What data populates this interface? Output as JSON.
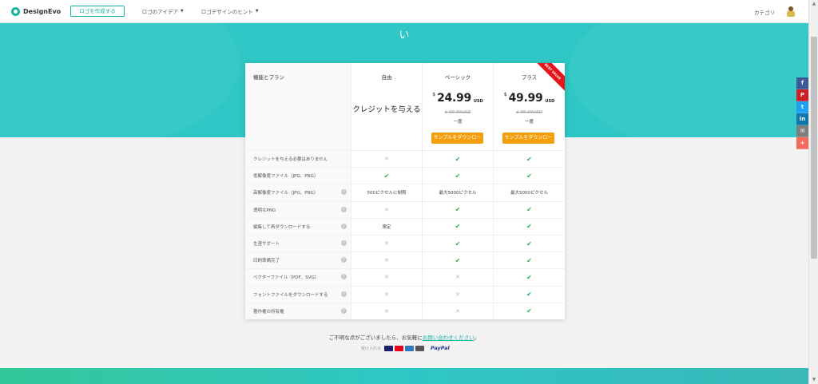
{
  "header": {
    "logo_text": "DesignEvo",
    "create_button": "ロゴを作成する",
    "nav": [
      {
        "label": "ロゴのアイデア"
      },
      {
        "label": "ロゴデザインのヒント"
      }
    ],
    "categories": "カテゴリ"
  },
  "hero": {
    "text": "い"
  },
  "share": [
    {
      "icon": "facebook-icon",
      "glyph": "f",
      "color": "#3b5998"
    },
    {
      "icon": "pinterest-icon",
      "glyph": "P",
      "color": "#cb2027"
    },
    {
      "icon": "twitter-icon",
      "glyph": "t",
      "color": "#1da1f2"
    },
    {
      "icon": "linkedin-icon",
      "glyph": "in",
      "color": "#0e76a8"
    },
    {
      "icon": "email-icon",
      "glyph": "✉",
      "color": "#7d7d7d"
    },
    {
      "icon": "plus-icon",
      "glyph": "+",
      "color": "#f26b5b"
    }
  ],
  "pricing": {
    "header_label": "機能とプラン",
    "plans": [
      {
        "name": "自由",
        "cta": "クレジットを与える"
      },
      {
        "name": "ベーシック",
        "currency": "$",
        "price": "24.99",
        "unit": "USD",
        "old_price": "$ 99.99USD",
        "period": "一度",
        "button": "サンプルをダウンロード"
      },
      {
        "name": "プラス",
        "currency": "$",
        "price": "49.99",
        "unit": "USD",
        "old_price": "$ 99.99USD",
        "period": "一度",
        "button": "サンプルをダウンロード",
        "ribbon": "BEST VALUE"
      }
    ],
    "features": [
      {
        "label": "クレジットを与える必要はありません",
        "info": false,
        "values": [
          "no",
          "yes",
          "yes"
        ]
      },
      {
        "label": "低解像度ファイル（JPG、PNG）",
        "info": false,
        "values": [
          "yes",
          "yes",
          "yes"
        ]
      },
      {
        "label": "高解像度ファイル（JPG、PNG）",
        "info": true,
        "values": [
          "500ピクセルに制限",
          "最大5000ピクセル",
          "最大5000ピクセル"
        ]
      },
      {
        "label": "透明なPNG",
        "info": true,
        "values": [
          "no",
          "yes",
          "yes"
        ]
      },
      {
        "label": "編集して再ダウンロードする",
        "info": true,
        "values": [
          "限定",
          "yes",
          "yes"
        ]
      },
      {
        "label": "生涯サポート",
        "info": true,
        "values": [
          "no",
          "yes",
          "yes"
        ]
      },
      {
        "label": "印刷準備完了",
        "info": true,
        "values": [
          "no",
          "yes",
          "yes"
        ]
      },
      {
        "label": "ベクターファイル（PDF、SVG）",
        "info": true,
        "values": [
          "no",
          "no",
          "yes"
        ]
      },
      {
        "label": "フォントファイルをダウンロードする",
        "info": true,
        "values": [
          "no",
          "no",
          "yes"
        ]
      },
      {
        "label": "著作権の所有権",
        "info": true,
        "values": [
          "no",
          "no",
          "yes"
        ]
      }
    ]
  },
  "footer": {
    "contact_before": "ご不明な点がございましたら、お気軽に",
    "contact_link": "お問い合わせください",
    "contact_after": "。",
    "accepted": "受け入れる",
    "cards": [
      {
        "icon": "visa-icon",
        "color": "#1a1f71"
      },
      {
        "icon": "mastercard-icon",
        "color": "#eb001b"
      },
      {
        "icon": "amex-icon",
        "color": "#2e77bc"
      },
      {
        "icon": "discover-icon",
        "color": "#555555"
      }
    ],
    "paypal": "PayPal"
  },
  "colors": {
    "accent": "#16b2a0",
    "hero": "#2ec7c5",
    "button": "#f59e0b",
    "check": "#22b14c"
  }
}
